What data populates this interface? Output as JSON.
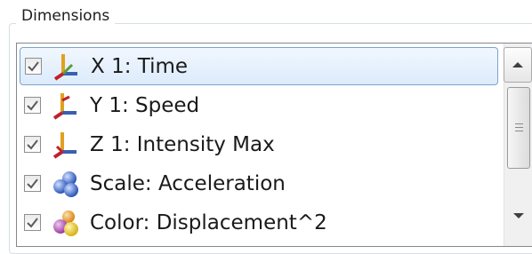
{
  "group": {
    "title": "Dimensions"
  },
  "dimensions": [
    {
      "label": "X 1: Time",
      "checked": true,
      "icon": "axis-icon",
      "selected": true
    },
    {
      "label": "Y 1: Speed",
      "checked": true,
      "icon": "axis-icon",
      "selected": false
    },
    {
      "label": "Z 1: Intensity Max",
      "checked": true,
      "icon": "axis-icon",
      "selected": false
    },
    {
      "label": "Scale: Acceleration",
      "checked": true,
      "icon": "spheres-icon",
      "selected": false
    },
    {
      "label": "Color: Displacement^2",
      "checked": true,
      "icon": "color-spheres-icon",
      "selected": false
    }
  ],
  "colors": {
    "selection_border": "#7da2ce",
    "checkmark": "#5a5a5a"
  }
}
